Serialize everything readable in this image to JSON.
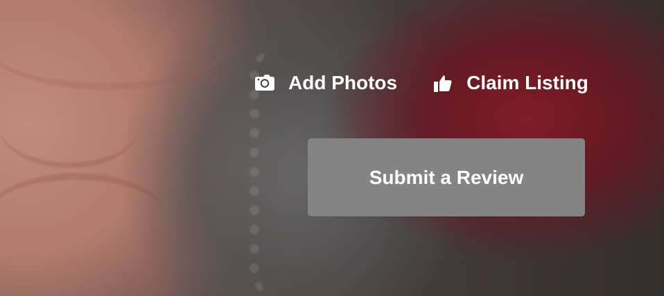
{
  "actions": {
    "add_photos": {
      "label": "Add Photos",
      "icon": "camera-icon"
    },
    "claim_listing": {
      "label": "Claim Listing",
      "icon": "thumbs-up-icon"
    }
  },
  "review": {
    "submit_label": "Submit a Review"
  },
  "colors": {
    "button_background": "#848484",
    "text": "#ffffff"
  }
}
